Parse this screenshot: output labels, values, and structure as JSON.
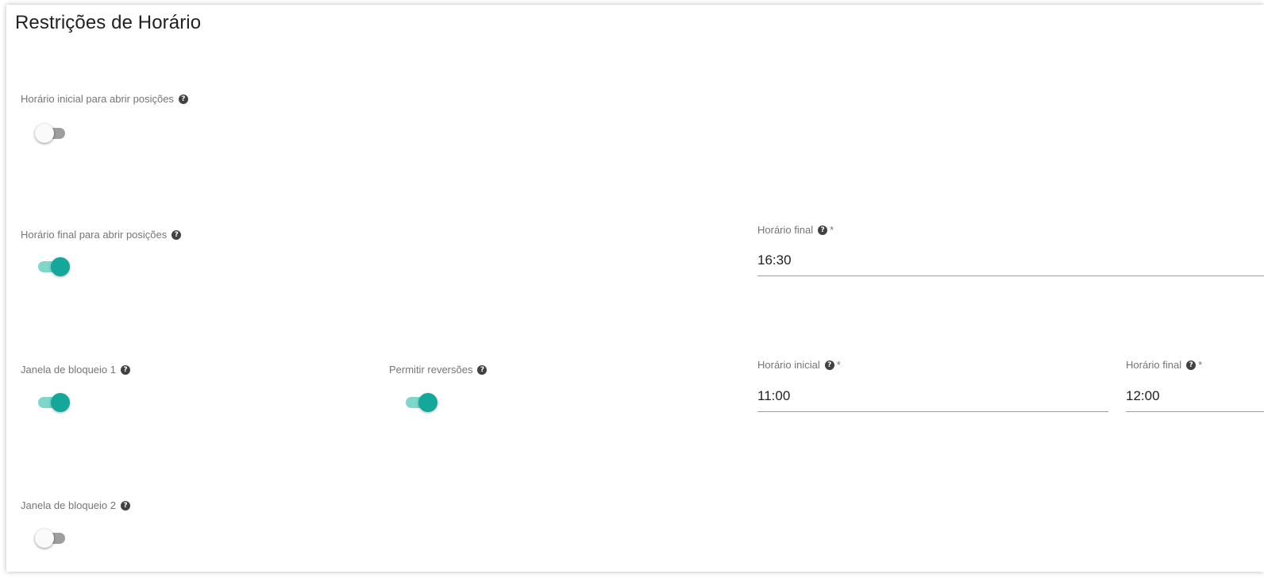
{
  "section": {
    "title": "Restrições de Horário"
  },
  "rows": {
    "initial_time": {
      "label": "Horário inicial para abrir posições",
      "enabled": false
    },
    "final_time": {
      "label": "Horário final para abrir posições",
      "enabled": true,
      "field_label": "Horário final",
      "field_required": "*",
      "field_value": "16:30"
    },
    "block_window_1": {
      "label": "Janela de bloqueio 1",
      "enabled": true,
      "reversals_label": "Permitir reversões",
      "reversals_enabled": true,
      "start_label": "Horário inicial",
      "start_required": "*",
      "start_value": "11:00",
      "end_label": "Horário final",
      "end_required": "*",
      "end_value": "12:00"
    },
    "block_window_2": {
      "label": "Janela de bloqueio 2",
      "enabled": false
    }
  },
  "icons": {
    "help": "question-circle-icon"
  },
  "colors": {
    "accent": "#14a89a",
    "accent_track": "#7fd6cb",
    "off_track": "#9e9e9e",
    "label": "#757575",
    "text": "#212121"
  }
}
